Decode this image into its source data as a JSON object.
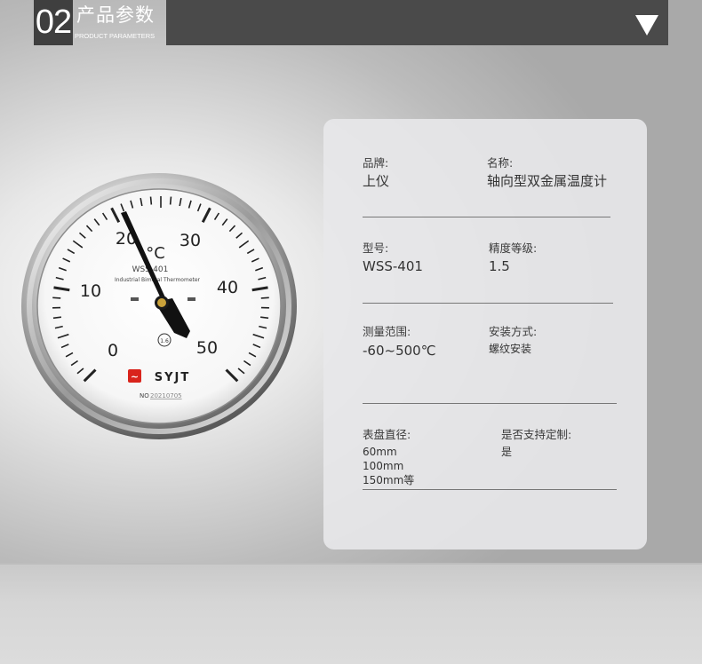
{
  "header": {
    "number": "02",
    "title_cn": "产品参数",
    "title_en": "PRODUCT PARAMETERS"
  },
  "gauge": {
    "unit": "°C",
    "model_text": "WSS-401",
    "subtitle": "Industrial Bimetal Thermometer",
    "scale_labels": [
      "0",
      "10",
      "20",
      "30",
      "40",
      "50"
    ],
    "accuracy_badge": "1.6",
    "logo_text": "SYJT",
    "serial_prefix": "NO",
    "serial_value": "20210705"
  },
  "params": {
    "brand_label": "品牌:",
    "brand_value": "上仪",
    "name_label": "名称:",
    "name_value": "轴向型双金属温度计",
    "model_label": "型号:",
    "model_value": "WSS-401",
    "accuracy_label": "精度等级:",
    "accuracy_value": "1.5",
    "range_label": "测量范围:",
    "range_value": "-60~500℃",
    "install_label": "安装方式:",
    "install_value": "螺纹安装",
    "dial_label": "表盘直径:",
    "dial_values": [
      "60mm",
      "100mm",
      "150mm等"
    ],
    "custom_label": "是否支持定制:",
    "custom_value": "是"
  },
  "colors": {
    "header_dark": "#3f3f3f",
    "header_bar": "#4a4a4a",
    "card_bg": "#e8e8ea",
    "logo_red": "#d9241c"
  }
}
